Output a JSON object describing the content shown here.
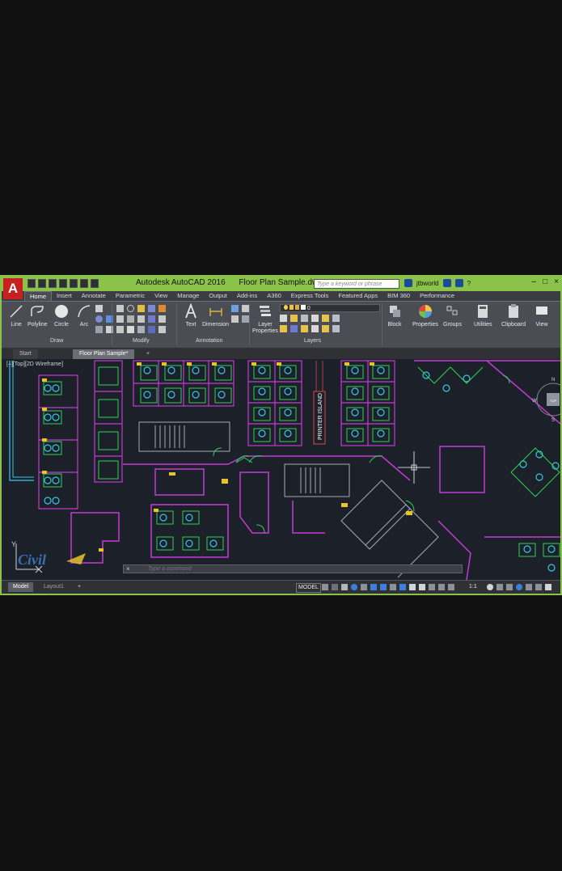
{
  "app": {
    "logo_letter": "A",
    "title": "Autodesk AutoCAD 2016",
    "filename": "Floor Plan Sample.dwg",
    "search_placeholder": "Type a keyword or phrase",
    "user": "jtbworld",
    "help": "?"
  },
  "window_controls": [
    "–",
    "□",
    "×"
  ],
  "ribbon_tabs": [
    "Home",
    "Insert",
    "Annotate",
    "Parametric",
    "View",
    "Manage",
    "Output",
    "Add-ins",
    "A360",
    "Express Tools",
    "Featured Apps",
    "BIM 360",
    "Performance"
  ],
  "draw_tools": [
    "Line",
    "Polyline",
    "Circle",
    "Arc"
  ],
  "panels": {
    "draw": "Draw",
    "modify": "Modify",
    "annotation": "Annotation",
    "layers": "Layers"
  },
  "annotation_tools": [
    "Text",
    "Dimension"
  ],
  "layer_properties": "Layer\nProperties",
  "layer_current": "0",
  "right_tools": [
    "Block",
    "Properties",
    "Groups",
    "Utilities",
    "Clipboard",
    "View"
  ],
  "doc_tabs": {
    "start": "Start",
    "active": "Floor Plan Sample*",
    "add": "+"
  },
  "viewport_label": "[–][Top][2D Wireframe]",
  "drawing": {
    "room_label": "PRINTER ISLAND",
    "viewcube": {
      "top": "TOP",
      "north": "N",
      "south": "S",
      "west": "W"
    },
    "ucs_y": "Y",
    "ucs_x": "X",
    "watermark": "Civil"
  },
  "command_line": {
    "close": "×",
    "placeholder": "Type a command"
  },
  "layout_tabs": [
    "Model",
    "Layout1",
    "+"
  ],
  "status": {
    "space": "MODEL",
    "scale": "1:1"
  },
  "colors": {
    "app_border": "#8bc34a",
    "background": "#1c2029",
    "walls": "#c43ad6",
    "furniture": "#2fd158",
    "fixtures": "#35c9e8",
    "tags": "#e8c32a"
  }
}
